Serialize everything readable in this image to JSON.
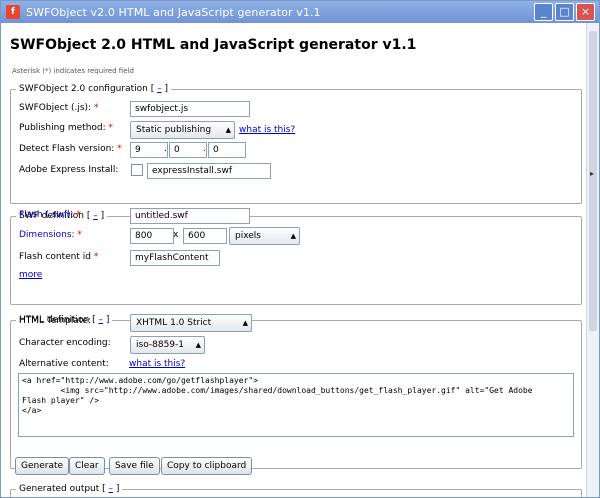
{
  "window": {
    "title": "SWFObject v2.0 HTML and JavaScript generator v1.1",
    "min": "_",
    "max": "□",
    "close": "×"
  },
  "page": {
    "title": "SWFObject 2.0 HTML and JavaScript generator v1.1",
    "required_note": "Asterisk (*) indicates required field"
  },
  "config": {
    "legend": "SWFObject 2.0 configuration [ ",
    "legend_toggle": "–",
    "legend_end": " ]",
    "swfobject_label": "SWFObject (.js): ",
    "swfobject_value": "swfobject.js",
    "publishing_label": "Publishing method: ",
    "publishing_value": "Static publishing",
    "publishing_help": "what is this?",
    "flash_version_label": "Detect Flash version: ",
    "flash_version": [
      "9",
      "0",
      "0"
    ],
    "express_label": "Adobe Express Install:",
    "express_value": "expressInstall.swf"
  },
  "swf": {
    "legend": "SWF definition [ ",
    "legend_toggle": "–",
    "legend_end": " ]",
    "flash_label": "Flash (.swf): ",
    "flash_value": "untitled.swf",
    "dimensions_label": "Dimensions: ",
    "width": "800",
    "x": "x",
    "height": "600",
    "unit": "pixels",
    "content_id_label": "Flash content id ",
    "content_id_value": "myFlashContent",
    "more": "more"
  },
  "html": {
    "legend": "HTML definition [ ",
    "legend_toggle": "–",
    "legend_end": " ]",
    "template_label": "HTML Template:",
    "template_value": "XHTML 1.0 Strict",
    "encoding_label": "Character encoding:",
    "encoding_value": "iso-8859-1",
    "alt_label": "Alternative content:",
    "alt_help": "what is this?",
    "alt_code": "<a href=\"http://www.adobe.com/go/getflashplayer\">\n        <img src=\"http://www.adobe.com/images/shared/download_buttons/get_flash_player.gif\" alt=\"Get Adobe\nFlash player\" />\n</a>"
  },
  "buttons": {
    "generate": "Generate",
    "clear": "Clear",
    "save": "Save file",
    "copy": "Copy to clipboard"
  },
  "output": {
    "legend": "Generated output [ ",
    "legend_toggle": "–",
    "legend_end": " ]"
  },
  "required_mark": "*",
  "dot": "."
}
